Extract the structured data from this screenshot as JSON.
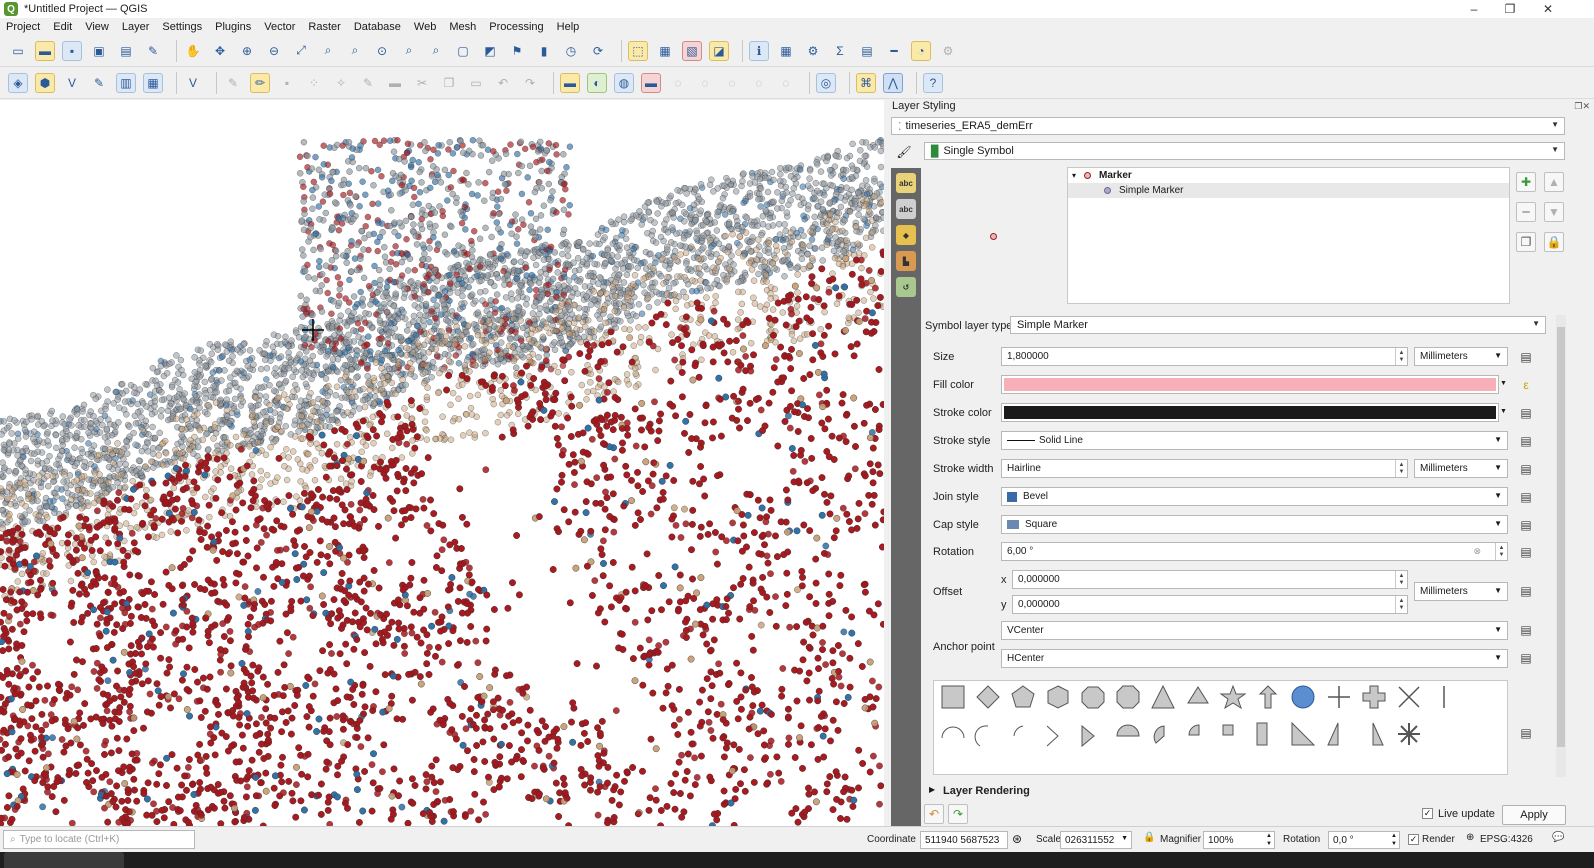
{
  "window": {
    "title": "*Untitled Project — QGIS",
    "controls": [
      "–",
      "❐",
      "✕"
    ]
  },
  "menu": [
    "Project",
    "Edit",
    "View",
    "Layer",
    "Settings",
    "Plugins",
    "Vector",
    "Raster",
    "Database",
    "Web",
    "Mesh",
    "Processing",
    "Help"
  ],
  "colors": {
    "marker_fill": "#f7b0b7",
    "marker_stroke": "#1a1a1a",
    "map_red": "#a5161c",
    "map_blue": "#2f6ea5",
    "map_grey": "#8c969e",
    "map_tan": "#c8a27a"
  },
  "dock": {
    "title": "Layer Styling",
    "layer": "timeseries_ERA5_demErr",
    "renderer": "Single Symbol",
    "tree": {
      "marker": "Marker",
      "layer": "Simple Marker"
    },
    "symbol_layer_type_label": "Symbol layer type",
    "symbol_layer_type": "Simple Marker",
    "props": {
      "size_label": "Size",
      "size": "1,800000",
      "size_unit": "Millimeters",
      "fill_label": "Fill color",
      "stroke_color_label": "Stroke color",
      "stroke_style_label": "Stroke style",
      "stroke_style": "Solid Line",
      "stroke_width_label": "Stroke width",
      "stroke_width": "Hairline",
      "stroke_width_unit": "Millimeters",
      "join_label": "Join style",
      "join": "Bevel",
      "cap_label": "Cap style",
      "cap": "Square",
      "rotation_label": "Rotation",
      "rotation": "6,00 °",
      "offset_label": "Offset",
      "offset_x_label": "x",
      "offset_x": "0,000000",
      "offset_y_label": "y",
      "offset_y": "0,000000",
      "offset_unit": "Millimeters",
      "anchor_label": "Anchor point",
      "anchor_v": "VCenter",
      "anchor_h": "HCenter"
    },
    "shapes_row1": [
      "square",
      "diamond",
      "pentagon",
      "hexagon",
      "octagon",
      "decagon",
      "triangle",
      "equilateral-triangle",
      "star",
      "arrow",
      "circle",
      "cross",
      "cross-fill",
      "x",
      "line"
    ],
    "shapes_row2": [
      "arc",
      "half-arc",
      "third-arc",
      "arrowhead",
      "filled-arrowhead",
      "semicircle",
      "third-circle",
      "quarter-circle",
      "quarter-square",
      "half-square",
      "right-half-triangle",
      "diagonal-half-square",
      "left-half-triangle",
      "asterisk"
    ],
    "layer_rendering": "Layer Rendering",
    "live_update": "Live update",
    "apply": "Apply"
  },
  "status": {
    "locate_placeholder": "Type to locate (Ctrl+K)",
    "coordinate_label": "Coordinate",
    "coordinate": "511940 5687523",
    "scale_label": "Scale",
    "scale": "026311552",
    "magnifier_label": "Magnifier",
    "magnifier": "100%",
    "rotation_label": "Rotation",
    "rotation": "0,0 °",
    "render_label": "Render",
    "crs": "EPSG:4326"
  }
}
